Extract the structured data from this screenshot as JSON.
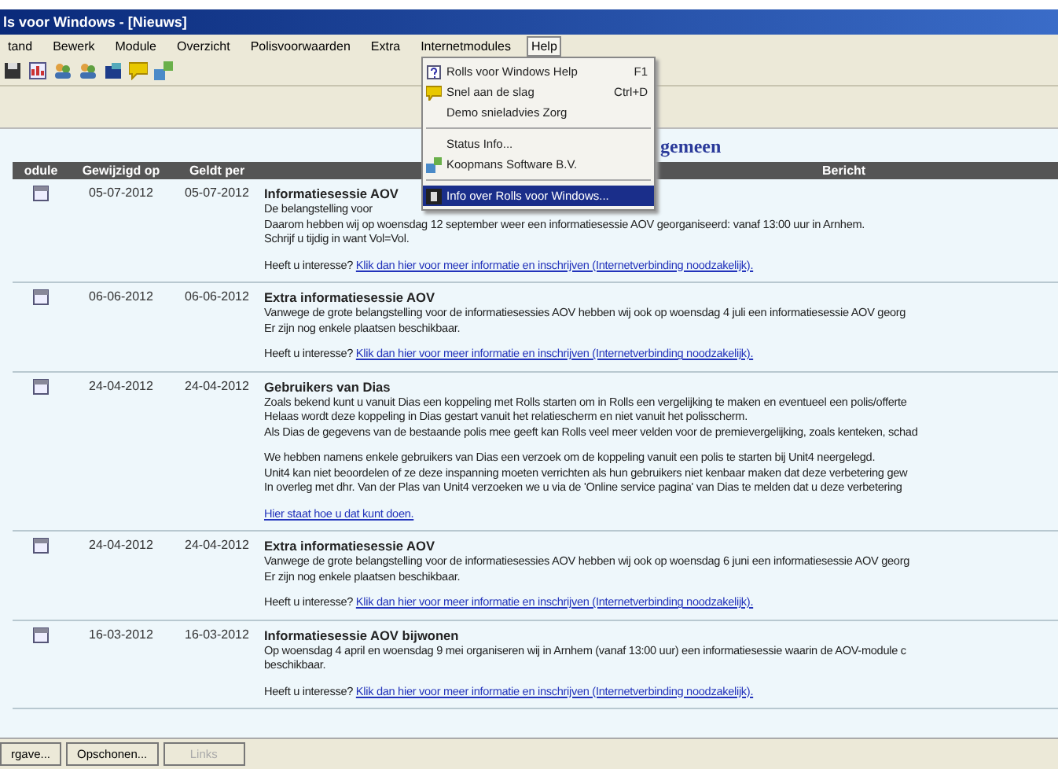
{
  "window": {
    "title": "ls voor Windows - [Nieuws]"
  },
  "menu_bar": [
    {
      "label": "tand",
      "open": false
    },
    {
      "label": "Bewerk",
      "open": false
    },
    {
      "label": "Module",
      "open": false
    },
    {
      "label": "Overzicht",
      "open": false
    },
    {
      "label": "Polisvoorwaarden",
      "open": false
    },
    {
      "label": "Extra",
      "open": false
    },
    {
      "label": "Internetmodules",
      "open": false
    },
    {
      "label": "Help",
      "open": true
    }
  ],
  "help_menu": [
    {
      "kind": "item",
      "label": "Rolls voor Windows Help",
      "shortcut": "F1",
      "selected": false
    },
    {
      "kind": "item",
      "label": "Snel aan de slag",
      "shortcut": "Ctrl+D",
      "selected": false
    },
    {
      "kind": "item",
      "label": "Demo snieladvies Zorg",
      "selected": false
    },
    {
      "kind": "separator"
    },
    {
      "kind": "item",
      "label": "Status Info...",
      "selected": false
    },
    {
      "kind": "item",
      "label": "Koopmans Software B.V.",
      "selected": false
    },
    {
      "kind": "separator"
    },
    {
      "kind": "item",
      "label": "Info over Rolls voor Windows...",
      "selected": true
    }
  ],
  "heading": "gemeen",
  "table": {
    "columns": [
      "odule",
      "Gewijzigd op",
      "Geldt per",
      "Bericht"
    ],
    "rows": [
      {
        "changed": "05-07-2012",
        "valid": "05-07-2012",
        "title": "Informatiesessie AOV",
        "paragraphs": [
          [
            "De belangstelling voor",
            "Daarom hebben wij op woensdag 12 september weer een informatiesessie AOV georganiseerd: vanaf 13:00 uur in Arnhem.",
            "Schrijf u tijdig in want Vol=Vol."
          ]
        ],
        "question": "Heeft u interesse?",
        "link": "Klik dan hier voor meer informatie en inschrijven (Internetverbinding noodzakelijk)."
      },
      {
        "changed": "06-06-2012",
        "valid": "06-06-2012",
        "title": "Extra informatiesessie AOV",
        "paragraphs": [
          [
            "Vanwege de grote belangstelling voor de informatiesessies AOV hebben wij ook op woensdag 4 juli een informatiesessie AOV georg",
            "Er zijn nog enkele plaatsen beschikbaar."
          ]
        ],
        "question": "Heeft u interesse?",
        "link": "Klik dan hier voor meer informatie en inschrijven (Internetverbinding noodzakelijk)."
      },
      {
        "changed": "24-04-2012",
        "valid": "24-04-2012",
        "title": "Gebruikers van Dias",
        "paragraphs": [
          [
            "Zoals bekend kunt u vanuit Dias een koppeling met Rolls starten om in Rolls een vergelijking te maken en eventueel een polis/offerte",
            "Helaas wordt deze koppeling in Dias gestart vanuit het relatiescherm en niet vanuit het polisscherm.",
            "Als Dias de gegevens van de bestaande polis mee geeft kan Rolls veel meer velden voor de premievergelijking, zoals kenteken, schad"
          ],
          [
            "We hebben namens enkele gebruikers van Dias een verzoek om de koppeling vanuit een polis te starten bij Unit4 neergelegd.",
            "Unit4 kan niet beoordelen of ze deze inspanning moeten verrichten als hun gebruikers niet kenbaar maken dat deze verbetering gew",
            "In overleg met dhr. Van der Plas van Unit4 verzoeken we u via de 'Online service pagina' van Dias te melden dat u deze verbetering"
          ]
        ],
        "link": "Hier staat hoe u dat kunt doen."
      },
      {
        "changed": "24-04-2012",
        "valid": "24-04-2012",
        "title": "Extra informatiesessie AOV",
        "paragraphs": [
          [
            "Vanwege de grote belangstelling voor de informatiesessies AOV hebben wij ook op woensdag 6 juni een informatiesessie AOV georg",
            "Er zijn nog enkele plaatsen beschikbaar."
          ]
        ],
        "question": "Heeft u interesse?",
        "link": "Klik dan hier voor meer informatie en inschrijven (Internetverbinding noodzakelijk)."
      },
      {
        "changed": "16-03-2012",
        "valid": "16-03-2012",
        "title": "Informatiesessie AOV bijwonen",
        "paragraphs": [
          [
            "Op woensdag 4 april en woensdag 9 mei organiseren wij in Arnhem (vanaf 13:00 uur) een informatiesessie waarin de AOV-module c",
            "beschikbaar."
          ]
        ],
        "question": "Heeft u interesse?",
        "link": "Klik dan hier voor meer informatie en inschrijven (Internetverbinding noodzakelijk)."
      }
    ]
  },
  "buttons": [
    {
      "label": "rgave...",
      "disabled": false
    },
    {
      "label": "Opschonen...",
      "disabled": false
    },
    {
      "label": "Links",
      "disabled": true
    }
  ]
}
